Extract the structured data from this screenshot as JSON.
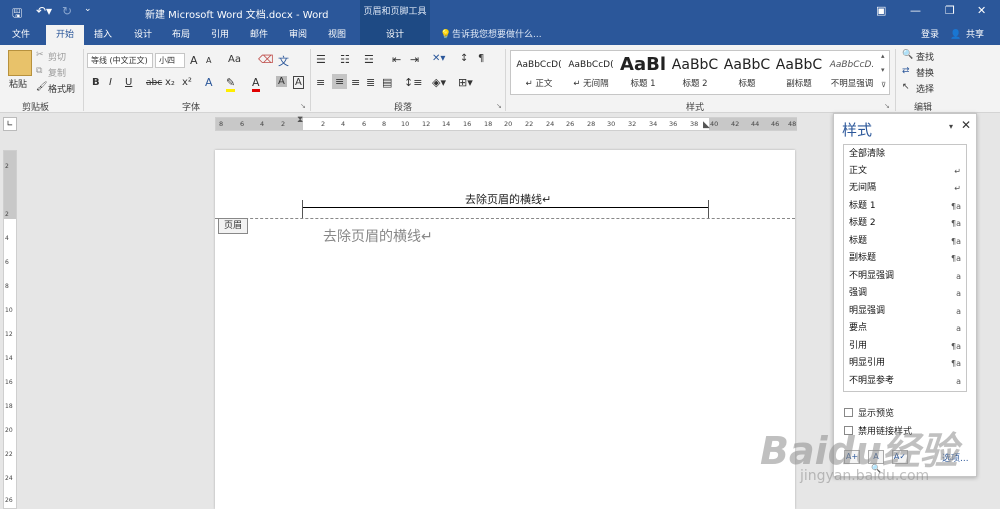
{
  "title_bar": {
    "title": "新建 Microsoft Word 文档.docx - Word",
    "context_tool": "页眉和页脚工具",
    "login": "登录",
    "share": "共享"
  },
  "tabs": [
    "文件",
    "开始",
    "插入",
    "设计",
    "布局",
    "引用",
    "邮件",
    "审阅",
    "视图",
    "设计"
  ],
  "tell_me": "告诉我您想要做什么...",
  "clipboard": {
    "paste": "粘贴",
    "cut": "剪切",
    "copy": "复制",
    "format_painter": "格式刷",
    "label": "剪贴板"
  },
  "font": {
    "name": "等线 (中文正文)",
    "size": "小四",
    "grow": "A",
    "shrink": "A",
    "case": "Aa",
    "bold": "B",
    "italic": "I",
    "underline": "U",
    "strike": "abc",
    "sub": "x₂",
    "sup": "x²",
    "label": "字体"
  },
  "paragraph": {
    "label": "段落"
  },
  "styles": {
    "label": "样式",
    "gallery": [
      {
        "preview": "AaBbCcD(",
        "name": "↵ 正文"
      },
      {
        "preview": "AaBbCcD(",
        "name": "↵ 无间隔"
      },
      {
        "preview": "AaBl",
        "name": "标题 1"
      },
      {
        "preview": "AaBbC",
        "name": "标题 2"
      },
      {
        "preview": "AaBbC",
        "name": "标题"
      },
      {
        "preview": "AaBbC",
        "name": "副标题"
      },
      {
        "preview": "AaBbCcD.",
        "name": "不明显强调"
      }
    ]
  },
  "editing": {
    "find": "查找",
    "replace": "替换",
    "select": "选择",
    "label": "编辑"
  },
  "ruler_h": [
    "8",
    "6",
    "4",
    "2",
    "2",
    "4",
    "6",
    "8",
    "10",
    "12",
    "14",
    "16",
    "18",
    "20",
    "22",
    "24",
    "26",
    "28",
    "30",
    "32",
    "34",
    "36",
    "38",
    "40",
    "42",
    "44",
    "46",
    "48"
  ],
  "ruler_v": [
    "2",
    "2",
    "4",
    "6",
    "8",
    "10",
    "12",
    "14",
    "16",
    "18",
    "20",
    "22",
    "24",
    "26"
  ],
  "document": {
    "header_text": "去除页眉的横线↵",
    "header_tag": "页眉",
    "body_text": "去除页眉的横线↵"
  },
  "styles_pane": {
    "title": "样式",
    "items": [
      {
        "name": "全部清除",
        "mark": ""
      },
      {
        "name": "正文",
        "mark": "↵"
      },
      {
        "name": "无间隔",
        "mark": "↵"
      },
      {
        "name": "标题 1",
        "mark": "¶a"
      },
      {
        "name": "标题 2",
        "mark": "¶a"
      },
      {
        "name": "标题",
        "mark": "¶a"
      },
      {
        "name": "副标题",
        "mark": "¶a"
      },
      {
        "name": "不明显强调",
        "mark": "a"
      },
      {
        "name": "强调",
        "mark": "a"
      },
      {
        "name": "明显强调",
        "mark": "a"
      },
      {
        "name": "要点",
        "mark": "a"
      },
      {
        "name": "引用",
        "mark": "¶a"
      },
      {
        "name": "明显引用",
        "mark": "¶a"
      },
      {
        "name": "不明显参考",
        "mark": "a"
      }
    ],
    "show_preview": "显示预览",
    "disable_linked": "禁用链接样式",
    "options": "选项..."
  },
  "watermark": {
    "brand": "Baidu经验",
    "url": "jingyan.baidu.com"
  },
  "colors": {
    "word_blue": "#2b579a",
    "ribbon_bg": "#f3f3f3"
  }
}
